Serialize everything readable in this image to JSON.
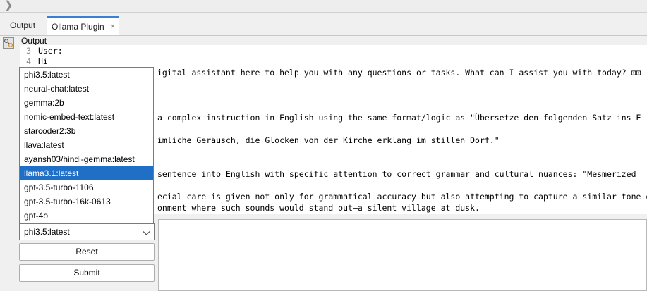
{
  "tabs": [
    {
      "label": "Output"
    },
    {
      "label": "Ollama Plugin",
      "close": "×"
    }
  ],
  "output_label": "Output",
  "editor": {
    "lines": [
      {
        "num": "3",
        "text": "User:"
      },
      {
        "num": "4",
        "text": "Hi"
      },
      {
        "num": "",
        "text": "igital assistant here to help you with any questions or tasks. What can I assist you with today? ⊡⊡"
      },
      {
        "num": "",
        "text": "a complex instruction in English using the same format/logic as \"Übersetze den folgenden Satz ins E"
      },
      {
        "num": "",
        "text": "imliche Geräusch, die Glocken von der Kirche erklang im stillen Dorf.\""
      },
      {
        "num": "",
        "text": "sentence into English with specific attention to correct grammar and cultural nuances: \"Mesmerized"
      },
      {
        "num": "",
        "text": "ecial care is given not only for grammatical accuracy but also attempting to capture a similar tone o"
      },
      {
        "num": "",
        "text": "onment where such sounds would stand out—a silent village at dusk."
      }
    ]
  },
  "model_dropdown": {
    "options": [
      "phi3.5:latest",
      "neural-chat:latest",
      "gemma:2b",
      "nomic-embed-text:latest",
      "starcoder2:3b",
      "llava:latest",
      "ayansh03/hindi-gemma:latest",
      "llama3.1:latest",
      "gpt-3.5-turbo-1106",
      "gpt-3.5-turbo-16k-0613",
      "gpt-4o"
    ],
    "highlighted": "llama3.1:latest",
    "selected": "phi3.5:latest"
  },
  "buttons": {
    "reset": "Reset",
    "submit": "Submit"
  },
  "colors": {
    "accent": "#1f6fc6",
    "tab_underline": "#3b7fd4"
  }
}
